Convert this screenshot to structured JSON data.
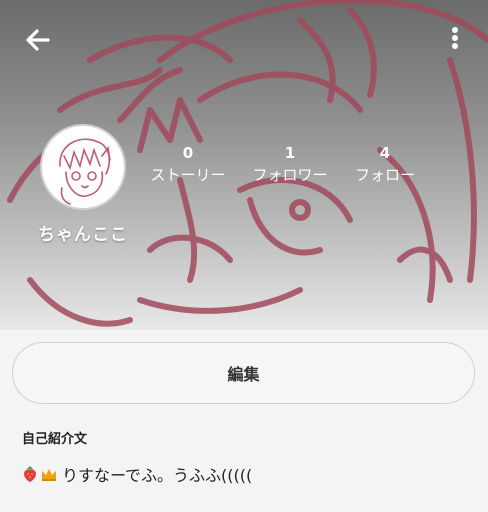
{
  "profile": {
    "username": "ちゃんここ",
    "stats": {
      "stories": {
        "count": "0",
        "label": "ストーリー"
      },
      "followers": {
        "count": "1",
        "label": "フォロワー"
      },
      "following": {
        "count": "4",
        "label": "フォロー"
      }
    }
  },
  "actions": {
    "edit_label": "編集"
  },
  "bio": {
    "heading": "自己紹介文",
    "emojis": [
      "strawberry",
      "crown"
    ],
    "text": "りすなーでふ。うふふ((((("
  },
  "icons": {
    "back": "back-arrow-icon",
    "more": "more-vertical-icon"
  },
  "colors": {
    "header_line_art": "#a14a5c",
    "page_background": "#f4f4f4"
  }
}
